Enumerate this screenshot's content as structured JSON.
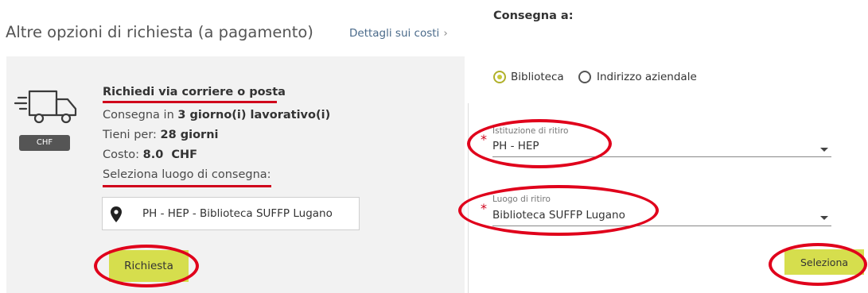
{
  "left_panel": {
    "title": "Altre opzioni di richiesta (a pagamento)",
    "cost_details_link": "Dettagli sui costi",
    "currency_badge": "CHF",
    "option": {
      "title": "Richiedi via corriere o posta",
      "delivery_prefix": "Consegna in ",
      "delivery_value": "3 giorno(i) lavorativo(i)",
      "keep_prefix": "Tieni per: ",
      "keep_value": "28 giorni",
      "cost_prefix": "Costo: ",
      "cost_value": "8.0  CHF",
      "select_place_label": "Seleziona luogo di consegna:",
      "location_value": "PH - HEP - Biblioteca SUFFP Lugano",
      "request_button": "Richiesta"
    }
  },
  "right_panel": {
    "deliver_to_label": "Consegna a:",
    "radio_options": [
      {
        "label": "Biblioteca",
        "selected": true
      },
      {
        "label": "Indirizzo aziendale",
        "selected": false
      }
    ],
    "institution_field": {
      "label": "Istituzione di ritiro",
      "value": "PH - HEP",
      "required": "*"
    },
    "pickup_field": {
      "label": "Luogo di ritiro",
      "value": "Biblioteca SUFFP Lugano",
      "required": "*"
    },
    "select_button": "Seleziona"
  },
  "colors": {
    "accent_button": "#d6de4d",
    "annotation_red": "#e0001b",
    "card_background": "#f2f2f2"
  }
}
